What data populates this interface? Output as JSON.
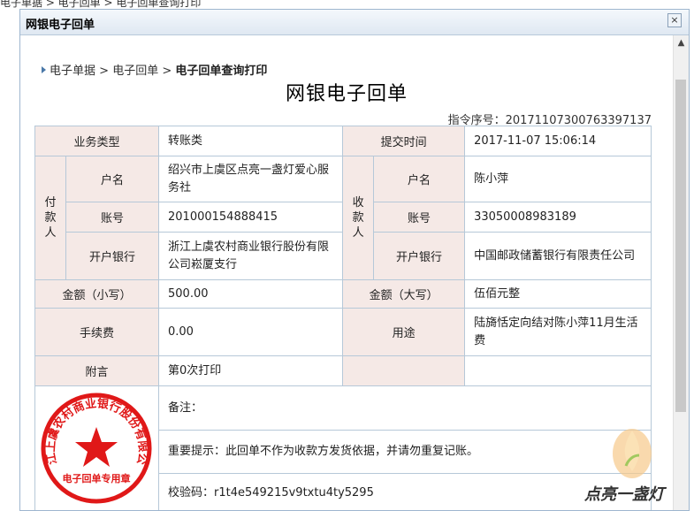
{
  "background": {
    "breadcrumb": "电子单据 > 电子回单 > 电子回单查询打印"
  },
  "dialog": {
    "title": "网银电子回单",
    "close_label": "×"
  },
  "breadcrumb": {
    "items": [
      "电子单据",
      "电子回单"
    ],
    "current": "电子回单查询打印",
    "separator": " > "
  },
  "doc": {
    "title": "网银电子回单",
    "serial": "指令序号：20171107300763397137"
  },
  "labels": {
    "biz_type": "业务类型",
    "submit_time": "提交时间",
    "payer_group": "付款人",
    "payee_group": "收款人",
    "name": "户名",
    "account": "账号",
    "bank": "开户银行",
    "amount_small": "金额（小写）",
    "amount_big": "金额（大写）",
    "fee": "手续费",
    "purpose": "用途",
    "postscript": "附言",
    "remark": "备注：",
    "notice": "重要提示：此回单不作为收款方发货依据，并请勿重复记账。"
  },
  "values": {
    "biz_type": "转账类",
    "submit_time": "2017-11-07 15:06:14",
    "payer_name": "绍兴市上虞区点亮一盏灯爱心服务社",
    "payer_account": "201000154888415",
    "payer_bank": "浙江上虞农村商业银行股份有限公司崧厦支行",
    "payee_name": "陈小萍",
    "payee_account": "33050008983189",
    "payee_bank": "中国邮政储蓄银行有限责任公司",
    "amount_small": "500.00",
    "amount_big": "伍佰元整",
    "fee": "0.00",
    "purpose": "陆旖恬定向结对陈小萍11月生活费",
    "postscript": "第0次打印",
    "verify_code": "校验码：r1t4e549215v9txtu4ty5295"
  },
  "stamp": {
    "outer_text": "浙江上虞农村商业银行股份有限公司",
    "inner_text": "电子回单专用章",
    "color": "#e01818"
  },
  "watermark": {
    "text": "点亮一盏灯"
  },
  "colors": {
    "label_bg": "#f5e9e6",
    "border": "#b6c8d8",
    "breadcrumb_tri": "#4a78a8"
  }
}
